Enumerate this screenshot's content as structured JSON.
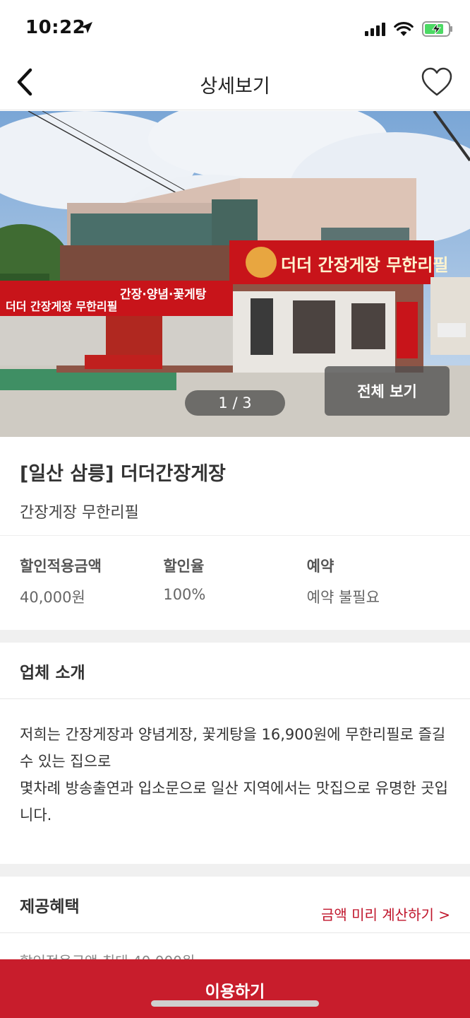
{
  "status_bar": {
    "time": "10:22",
    "icons": [
      "location-arrow-icon",
      "cellular-signal-icon",
      "wifi-icon",
      "battery-charging-icon"
    ],
    "battery_color": "#4cd964"
  },
  "header": {
    "title": "상세보기",
    "back_icon": "chevron-left-icon",
    "favorite_icon": "heart-outline-icon"
  },
  "gallery": {
    "counter": "1 / 3",
    "view_all_label": "전체 보기"
  },
  "store": {
    "name": "[일산 삼릉] 더더간장게장",
    "subtitle": "간장게장 무한리필"
  },
  "info": [
    {
      "label": "할인적용금액",
      "value": "40,000원"
    },
    {
      "label": "할인율",
      "value": "100%"
    },
    {
      "label": "예약",
      "value": "예약 불필요"
    }
  ],
  "intro": {
    "title": "업체 소개",
    "body": "저희는 간장게장과 양념게장, 꽃게탕을 16,900원에 무한리필로 즐길 수 있는 집으로\n몇차례 방송출연과 입소문으로 일산 지역에서는 맛집으로 유명한 곳입니다."
  },
  "benefits": {
    "title": "제공혜택",
    "calc_link": "금액 미리 계산하기 >",
    "peek_text": "할인적용금액 최대 40,000원"
  },
  "cta": {
    "label": "이용하기",
    "color": "#c81d2c"
  },
  "colors": {
    "accent": "#c81d2c",
    "link": "#c0152b"
  }
}
